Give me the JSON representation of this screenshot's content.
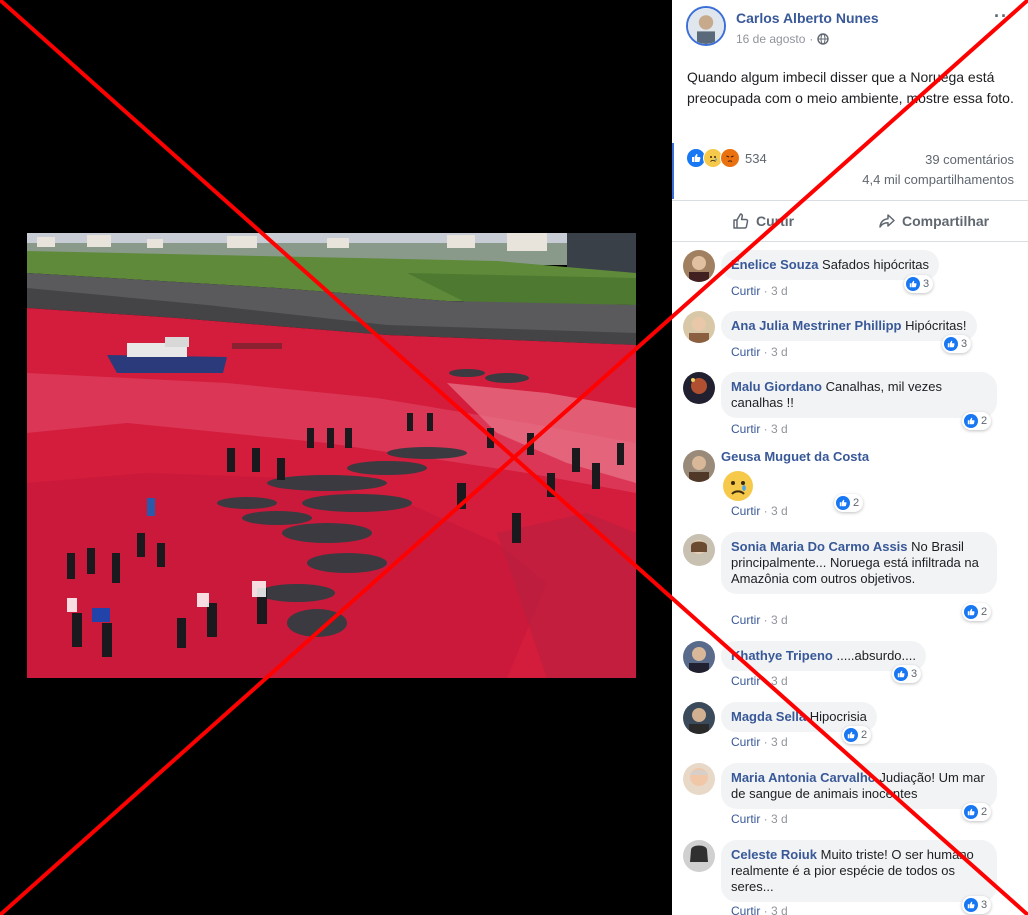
{
  "post": {
    "author": "Carlos Alberto Nunes",
    "date": "16 de agosto",
    "separator": "·",
    "audience_icon": "globe-icon",
    "menu_label": "···",
    "text": "Quando algum imbecil disser que a Noruega está preocupada com o meio ambiente, mostre essa foto.",
    "reactions": {
      "icons": [
        "like-icon",
        "sad-icon",
        "angry-icon"
      ],
      "count": "534"
    },
    "comments_count": "39 comentários",
    "shares_count": "4,4 mil compartilhamentos",
    "like_label": "Curtir",
    "share_label": "Compartilhar"
  },
  "comments": [
    {
      "name": "Enelice Souza",
      "text": "Safados hipócritas",
      "reply": "Curtir",
      "time": "3 d",
      "likes": "3"
    },
    {
      "name": "Ana Julia Mestriner Phillipp",
      "text": "Hipócritas!",
      "reply": "Curtir",
      "time": "3 d",
      "likes": "3"
    },
    {
      "name": "Malu Giordano",
      "text": "Canalhas, mil vezes canalhas !!",
      "reply": "Curtir",
      "time": "3 d",
      "likes": "2"
    },
    {
      "name": "Geusa Muguet da Costa",
      "text": "",
      "reply": "Curtir",
      "time": "3 d",
      "likes": "2",
      "emoji": "sad-face-emoji"
    },
    {
      "name": "Sonia Maria Do Carmo Assis",
      "text": "No Brasil principalmente... Noruega está infiltrada na Amazônia com outros objetivos.",
      "reply": "Curtir",
      "time": "3 d",
      "likes": "2"
    },
    {
      "name": "Khathye Tripeno",
      "text": ".....absurdo....",
      "reply": "Curtir",
      "time": "3 d",
      "likes": "3"
    },
    {
      "name": "Magda Sella",
      "text": "Hipocrisia",
      "reply": "Curtir",
      "time": "3 d",
      "likes": "2"
    },
    {
      "name": "Maria Antonia Carvalho",
      "text": "Judiação! Um mar de sangue de animais inocentes",
      "reply": "Curtir",
      "time": "3 d",
      "likes": "2"
    },
    {
      "name": "Celeste Roiuk",
      "text": "Muito triste! O ser humano realmente é a pior espécie de todos os seres...",
      "reply": "Curtir",
      "time": "3 d",
      "likes": "3"
    }
  ],
  "overlay": {
    "type": "red-x-cross",
    "color": "#ff0000"
  },
  "colors": {
    "sea_blood": "#d41c3c",
    "link": "#385898",
    "accent": "#1877f2"
  }
}
